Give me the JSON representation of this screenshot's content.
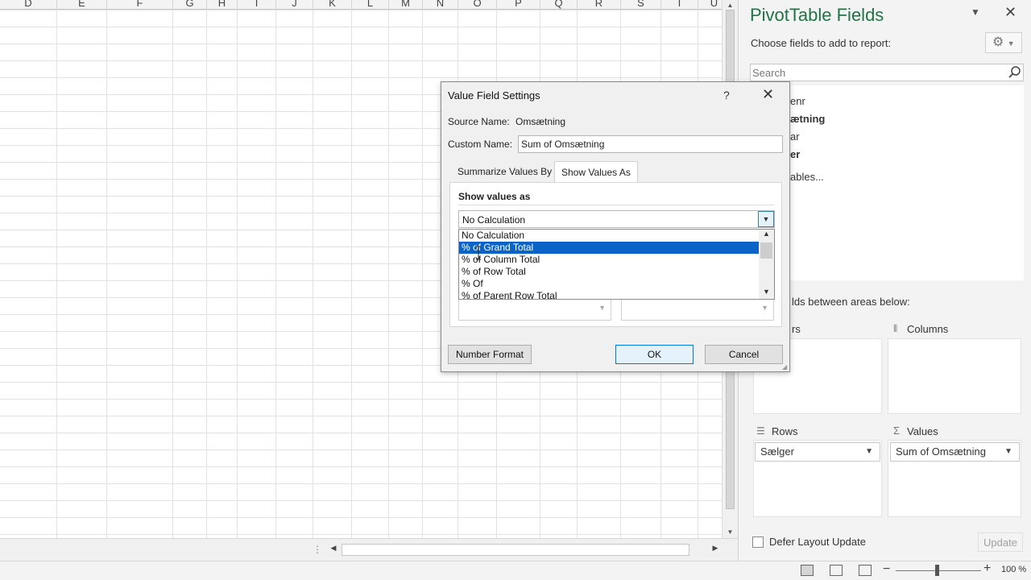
{
  "sheet": {
    "columns": [
      "D",
      "E",
      "F",
      "G",
      "H",
      "I",
      "J",
      "K",
      "L",
      "M",
      "N",
      "O",
      "P",
      "Q",
      "R",
      "S",
      "T",
      "U"
    ]
  },
  "dialog": {
    "title": "Value Field Settings",
    "help_glyph": "?",
    "close_glyph": "✕",
    "source_label": "Source Name:",
    "source_value": "Omsætning",
    "custom_label": "Custom Name:",
    "custom_value": "Sum of Omsætning",
    "tabs": [
      "Summarize Values By",
      "Show Values As"
    ],
    "active_tab": "Show Values As",
    "show_values_heading": "Show values as",
    "selected_calculation": "No Calculation",
    "options": [
      "No Calculation",
      "% of Grand Total",
      "% of Column Total",
      "% of Row Total",
      "% Of",
      "% of Parent Row Total"
    ],
    "highlighted_option": "% of Grand Total",
    "buttons": {
      "number_format": "Number Format",
      "ok": "OK",
      "cancel": "Cancel"
    }
  },
  "pivot": {
    "title": "PivotTable Fields",
    "choose_label": "Choose fields to add to report:",
    "search_placeholder": "Search",
    "fields": [
      {
        "label": "enr",
        "bold": false
      },
      {
        "label": "ætning",
        "bold": true
      },
      {
        "label": "ar",
        "bold": false
      },
      {
        "label": "er",
        "bold": true
      },
      {
        "label": "ables...",
        "bold": false
      }
    ],
    "drag_label": "lds between areas below:",
    "areas": {
      "filters_label": "rs",
      "columns_label": "Columns",
      "rows_label": "Rows",
      "values_label": "Values",
      "rows_chip": "Sælger",
      "values_chip": "Sum of Omsætning"
    },
    "defer_label": "Defer Layout Update",
    "update_label": "Update"
  },
  "status": {
    "zoom": "100 %"
  },
  "colors": {
    "excel_green": "#217346",
    "selection_blue": "#0a64c8"
  }
}
